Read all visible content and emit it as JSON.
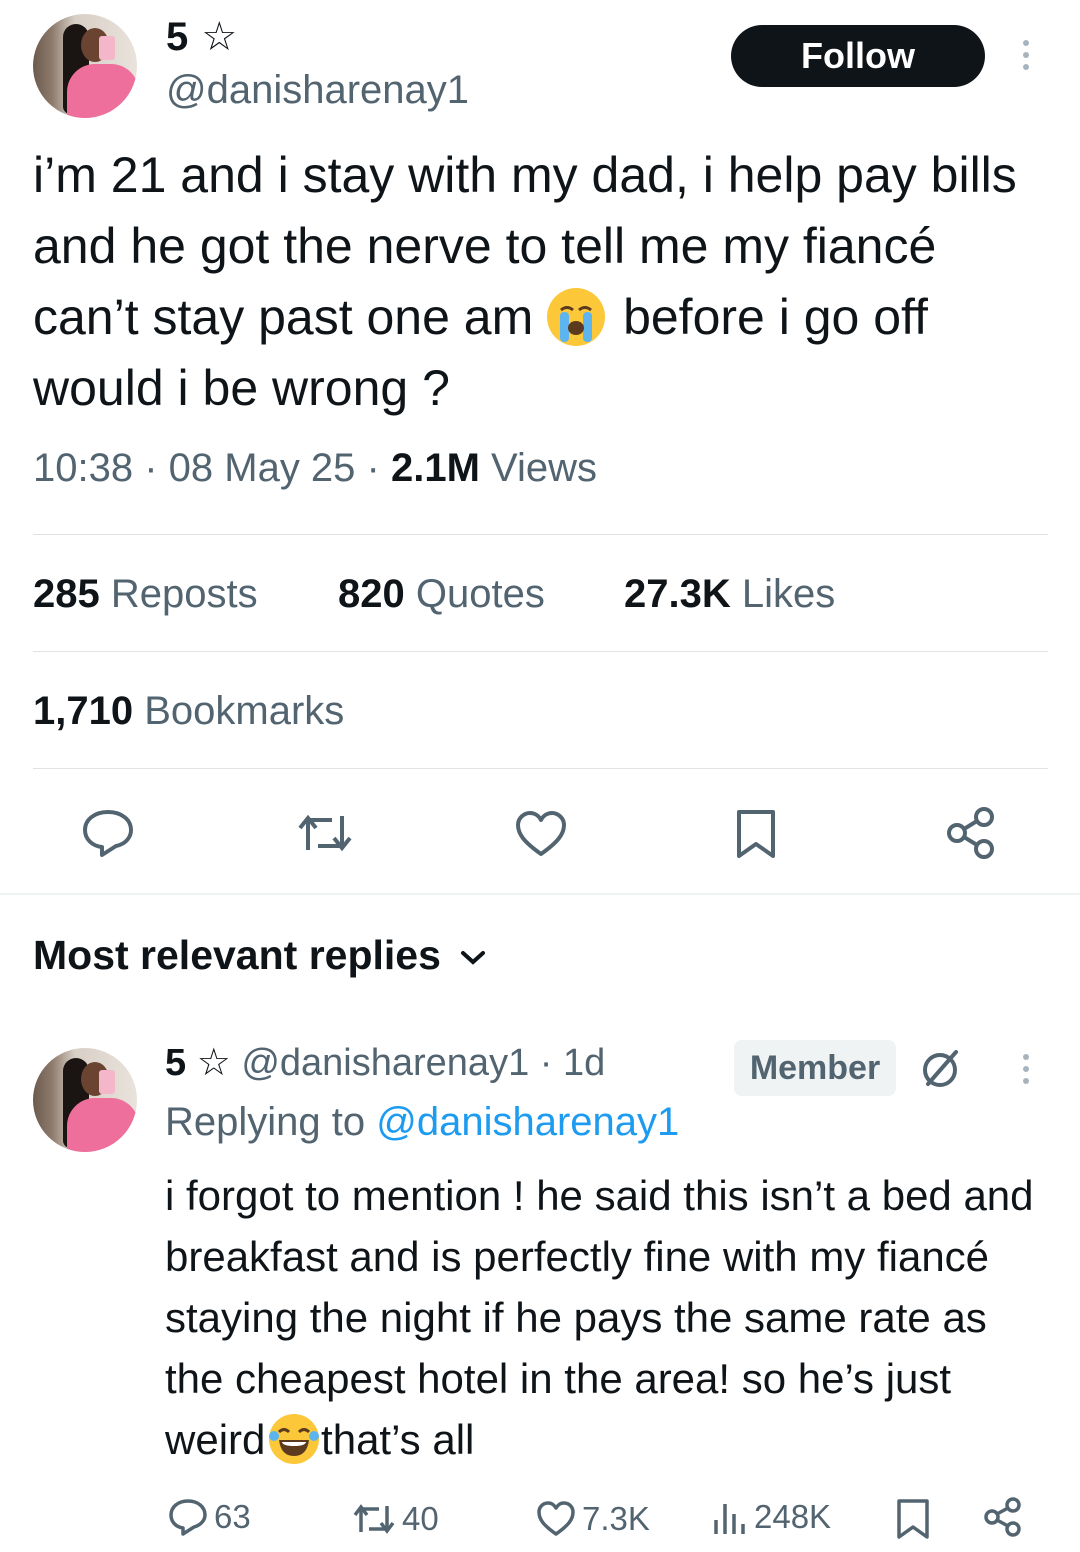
{
  "tweet": {
    "display_name": "5 ☆",
    "handle": "@danisharenay1",
    "follow_label": "Follow",
    "text_part1": "i’m 21 and i stay with my dad, i help pay bills and he got the nerve to tell me my fiancé can’t stay past one am ",
    "text_emoji": "crying-face",
    "text_part2": " before i go off would i be wrong ?",
    "time": "10:38 · 08 May 25 · ",
    "views_count": "2.1M",
    "views_label": " Views"
  },
  "stats": {
    "reposts_count": "285",
    "reposts_label": " Reposts",
    "quotes_count": "820",
    "quotes_label": " Quotes",
    "likes_count": "27.3K",
    "likes_label": " Likes",
    "bookmarks_count": "1,710",
    "bookmarks_label": " Bookmarks"
  },
  "actions": [
    "reply-icon",
    "repost-icon",
    "like-icon",
    "bookmark-icon",
    "share-icon"
  ],
  "replies_section": {
    "title": "Most relevant replies"
  },
  "reply": {
    "display_name": "5 ☆",
    "handle": "@danisharenay1",
    "age": " · 1d",
    "badge": "Member",
    "replying_prefix": "Replying to ",
    "replying_handle": "@danisharenay1",
    "text_part1": "i forgot to mention ! he said this isn’t a bed and breakfast and is perfectly fine with my fiancé staying the night if he pays the same rate as the cheapest hotel in the area! so he’s just weird ",
    "text_emoji": "laughing-tears-face",
    "text_part2": "that’s all",
    "replies_count": "63",
    "reposts_count": "40",
    "likes_count": "7.3K",
    "views_count": "248K"
  },
  "colors": {
    "text": "#0f1419",
    "secondary": "#536471",
    "link": "#1d9bf0",
    "divider": "#dfe3e6"
  }
}
